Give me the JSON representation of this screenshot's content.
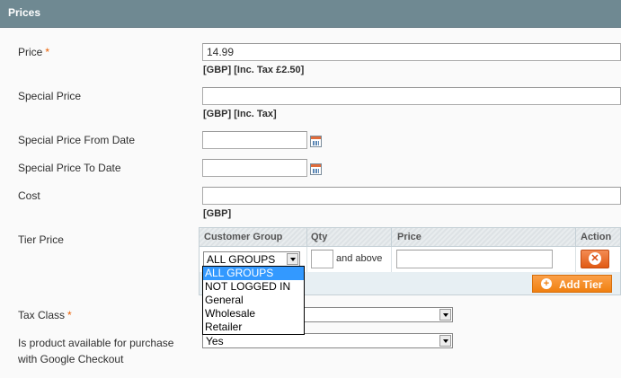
{
  "section": {
    "title": "Prices"
  },
  "price": {
    "label": "Price",
    "required_mark": "*",
    "value": "14.99",
    "note": "[GBP] [Inc. Tax £2.50]"
  },
  "special_price": {
    "label": "Special Price",
    "value": "",
    "note": "[GBP] [Inc. Tax]"
  },
  "special_from": {
    "label": "Special Price From Date",
    "value": ""
  },
  "special_to": {
    "label": "Special Price To Date",
    "value": ""
  },
  "cost": {
    "label": "Cost",
    "value": "",
    "note": "[GBP]"
  },
  "tier_price": {
    "label": "Tier Price",
    "headers": {
      "customer_group": "Customer Group",
      "qty": "Qty",
      "price": "Price",
      "action": "Action"
    },
    "row": {
      "group_selected": "ALL GROUPS",
      "qty": "",
      "qty_suffix": "and above",
      "price": ""
    },
    "group_options": [
      "ALL GROUPS",
      "NOT LOGGED IN",
      "General",
      "Wholesale",
      "Retailer"
    ],
    "add_label": "Add Tier"
  },
  "tax_class": {
    "label": "Tax Class",
    "required_mark": "*",
    "value": ""
  },
  "google_checkout": {
    "label_line1": "Is product available for purchase",
    "label_line2": "with Google Checkout",
    "value": "Yes"
  },
  "colors": {
    "header_bg": "#6f8992",
    "accent_orange": "#f08010",
    "required": "#eb5e00",
    "selection": "#3399ff"
  },
  "icons": {
    "calendar": "calendar-icon",
    "delete": "delete-icon",
    "add": "plus-icon",
    "dropdown": "chevron-down-icon"
  }
}
